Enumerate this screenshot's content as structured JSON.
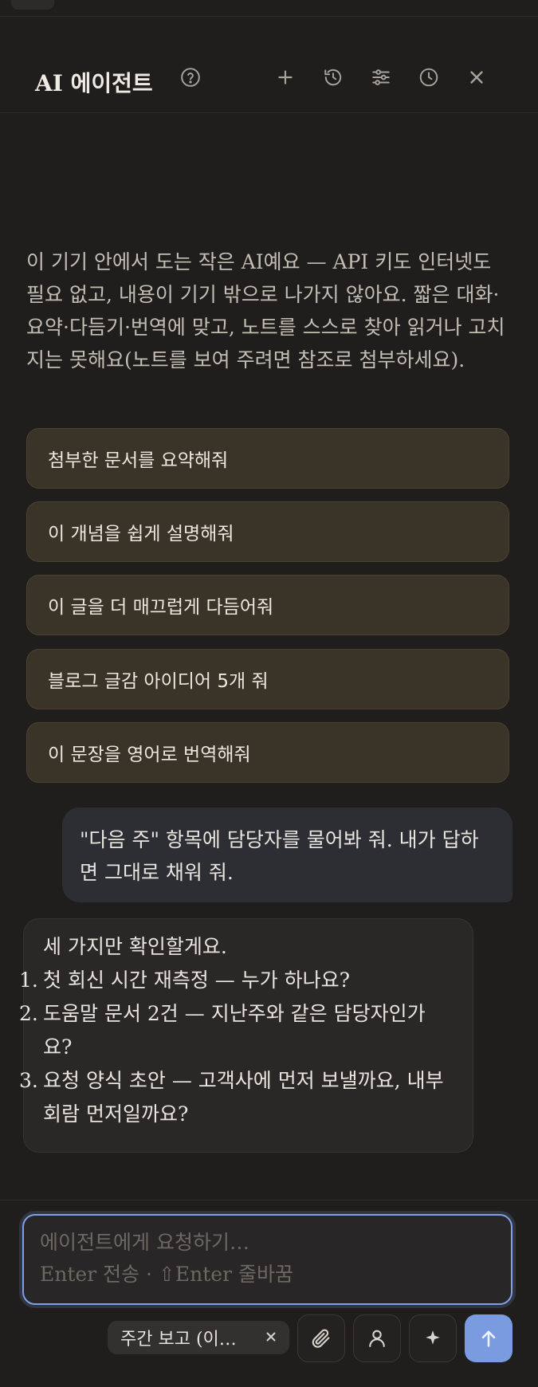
{
  "header": {
    "title": "AI 에이전트"
  },
  "intro": {
    "text": "이 기기 안에서 도는 작은 AI예요 — API 키도 인터넷도 필요 없고, 내용이 기기 밖으로 나가지 않아요. 짧은 대화·요약·다듬기·번역에 맞고, 노트를 스스로 찾아 읽거나 고치지는 못해요(노트를 보여 주려면 참조로 첨부하세요)."
  },
  "suggestions": [
    "첨부한 문서를 요약해줘",
    "이 개념을 쉽게 설명해줘",
    "이 글을 더 매끄럽게 다듬어줘",
    "블로그 글감 아이디어 5개 줘",
    "이 문장을 영어로 번역해줘"
  ],
  "conversation": {
    "user_message": "\"다음 주\" 항목에 담당자를 물어봐 줘. 내가 답하면 그대로 채워 줘.",
    "assistant_intro": "세 가지만 확인할게요.",
    "assistant_items": [
      {
        "num": "1.",
        "text": "첫 회신 시간 재측정 — 누가 하나요?"
      },
      {
        "num": "2.",
        "text": "도움말 문서 2건 — 지난주와 같은 담당자인가요?"
      },
      {
        "num": "3.",
        "text": "요청 양식 초안 — 고객사에 먼저 보낼까요, 내부 회람 먼저일까요?"
      }
    ]
  },
  "composer": {
    "placeholder_line1": "에이전트에게 요청하기…",
    "placeholder_line2": "Enter 전송 · ⇧Enter 줄바꿈",
    "value": ""
  },
  "reference_chip": {
    "label": "주간 보고 (이…"
  },
  "colors": {
    "background": "#201e1d",
    "suggestion_bg": "#3a3328",
    "accent": "#7a9be0",
    "user_bubble": "#2d2e34"
  }
}
